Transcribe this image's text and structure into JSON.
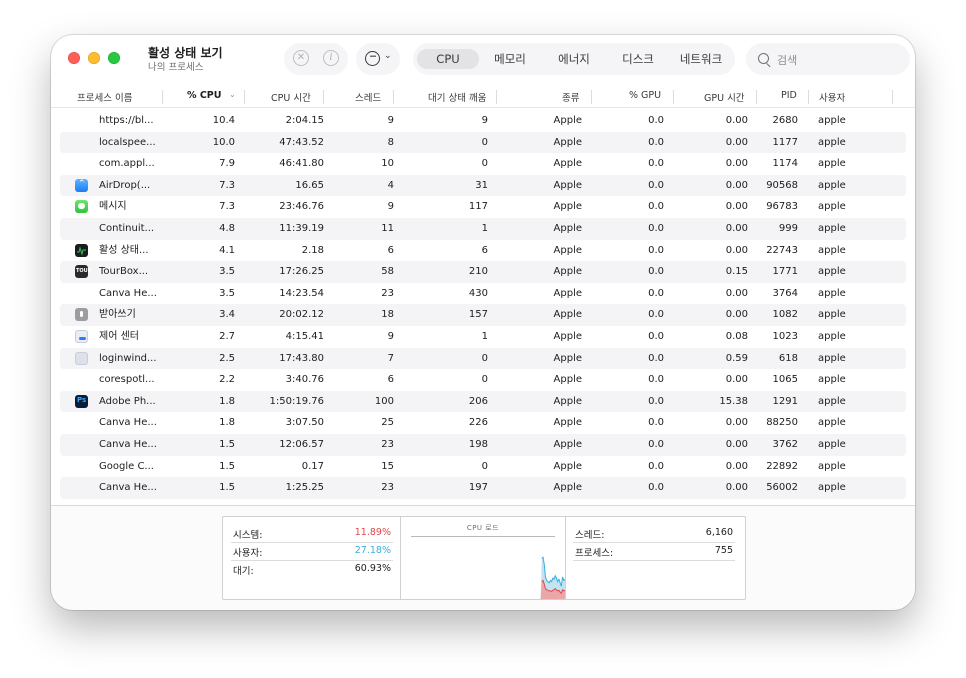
{
  "window": {
    "title": "활성 상태 보기",
    "subtitle": "나의 프로세스"
  },
  "toolbar": {
    "stop_icon": "x-circle-icon",
    "info_icon": "info-circle-icon",
    "more_icon": "ellipsis-circle-icon",
    "tabs": [
      "CPU",
      "메모리",
      "에너지",
      "디스크",
      "네트워크"
    ],
    "active_tab": "CPU",
    "search_placeholder": "검색"
  },
  "columns": [
    "프로세스 이름",
    "% CPU",
    "CPU 시간",
    "스레드",
    "대기 상태 깨움",
    "종류",
    "% GPU",
    "GPU 시간",
    "PID",
    "사용자"
  ],
  "sort_column": "% CPU",
  "rows": [
    {
      "name": "https://bl...",
      "cpu": "10.4",
      "cpu_time": "2:04.15",
      "threads": "9",
      "wakeups": "9",
      "kind": "Apple",
      "gpu": "0.0",
      "gpu_time": "0.00",
      "pid": "2680",
      "user": "apple",
      "icon": "none"
    },
    {
      "name": "localspee...",
      "cpu": "10.0",
      "cpu_time": "47:43.52",
      "threads": "8",
      "wakeups": "0",
      "kind": "Apple",
      "gpu": "0.0",
      "gpu_time": "0.00",
      "pid": "1177",
      "user": "apple",
      "icon": "none"
    },
    {
      "name": "com.appl...",
      "cpu": "7.9",
      "cpu_time": "46:41.80",
      "threads": "10",
      "wakeups": "0",
      "kind": "Apple",
      "gpu": "0.0",
      "gpu_time": "0.00",
      "pid": "1174",
      "user": "apple",
      "icon": "none"
    },
    {
      "name": "AirDrop(...",
      "cpu": "7.3",
      "cpu_time": "16.65",
      "threads": "4",
      "wakeups": "31",
      "kind": "Apple",
      "gpu": "0.0",
      "gpu_time": "0.00",
      "pid": "90568",
      "user": "apple",
      "icon": "airdrop-icon"
    },
    {
      "name": "메시지",
      "cpu": "7.3",
      "cpu_time": "23:46.76",
      "threads": "9",
      "wakeups": "117",
      "kind": "Apple",
      "gpu": "0.0",
      "gpu_time": "0.00",
      "pid": "96783",
      "user": "apple",
      "icon": "messages-icon"
    },
    {
      "name": "Continuit...",
      "cpu": "4.8",
      "cpu_time": "11:39.19",
      "threads": "11",
      "wakeups": "1",
      "kind": "Apple",
      "gpu": "0.0",
      "gpu_time": "0.00",
      "pid": "999",
      "user": "apple",
      "icon": "none"
    },
    {
      "name": "활성 상태...",
      "cpu": "4.1",
      "cpu_time": "2.18",
      "threads": "6",
      "wakeups": "6",
      "kind": "Apple",
      "gpu": "0.0",
      "gpu_time": "0.00",
      "pid": "22743",
      "user": "apple",
      "icon": "activity-monitor-icon"
    },
    {
      "name": "TourBox...",
      "cpu": "3.5",
      "cpu_time": "17:26.25",
      "threads": "58",
      "wakeups": "210",
      "kind": "Apple",
      "gpu": "0.0",
      "gpu_time": "0.15",
      "pid": "1771",
      "user": "apple",
      "icon": "tourbox-icon"
    },
    {
      "name": "Canva He...",
      "cpu": "3.5",
      "cpu_time": "14:23.54",
      "threads": "23",
      "wakeups": "430",
      "kind": "Apple",
      "gpu": "0.0",
      "gpu_time": "0.00",
      "pid": "3764",
      "user": "apple",
      "icon": "none"
    },
    {
      "name": "받아쓰기",
      "cpu": "3.4",
      "cpu_time": "20:02.12",
      "threads": "18",
      "wakeups": "157",
      "kind": "Apple",
      "gpu": "0.0",
      "gpu_time": "0.00",
      "pid": "1082",
      "user": "apple",
      "icon": "dictation-icon"
    },
    {
      "name": "제어 센터",
      "cpu": "2.7",
      "cpu_time": "4:15.41",
      "threads": "9",
      "wakeups": "1",
      "kind": "Apple",
      "gpu": "0.0",
      "gpu_time": "0.08",
      "pid": "1023",
      "user": "apple",
      "icon": "control-center-icon"
    },
    {
      "name": "loginwind...",
      "cpu": "2.5",
      "cpu_time": "17:43.80",
      "threads": "7",
      "wakeups": "0",
      "kind": "Apple",
      "gpu": "0.0",
      "gpu_time": "0.59",
      "pid": "618",
      "user": "apple",
      "icon": "loginwindow-icon"
    },
    {
      "name": "corespotl...",
      "cpu": "2.2",
      "cpu_time": "3:40.76",
      "threads": "6",
      "wakeups": "0",
      "kind": "Apple",
      "gpu": "0.0",
      "gpu_time": "0.00",
      "pid": "1065",
      "user": "apple",
      "icon": "none"
    },
    {
      "name": "Adobe Ph...",
      "cpu": "1.8",
      "cpu_time": "1:50:19.76",
      "threads": "100",
      "wakeups": "206",
      "kind": "Apple",
      "gpu": "0.0",
      "gpu_time": "15.38",
      "pid": "1291",
      "user": "apple",
      "icon": "photoshop-icon"
    },
    {
      "name": "Canva He...",
      "cpu": "1.8",
      "cpu_time": "3:07.50",
      "threads": "25",
      "wakeups": "226",
      "kind": "Apple",
      "gpu": "0.0",
      "gpu_time": "0.00",
      "pid": "88250",
      "user": "apple",
      "icon": "none"
    },
    {
      "name": "Canva He...",
      "cpu": "1.5",
      "cpu_time": "12:06.57",
      "threads": "23",
      "wakeups": "198",
      "kind": "Apple",
      "gpu": "0.0",
      "gpu_time": "0.00",
      "pid": "3762",
      "user": "apple",
      "icon": "none"
    },
    {
      "name": "Google C...",
      "cpu": "1.5",
      "cpu_time": "0.17",
      "threads": "15",
      "wakeups": "0",
      "kind": "Apple",
      "gpu": "0.0",
      "gpu_time": "0.00",
      "pid": "22892",
      "user": "apple",
      "icon": "none"
    },
    {
      "name": "Canva He...",
      "cpu": "1.5",
      "cpu_time": "1:25.25",
      "threads": "23",
      "wakeups": "197",
      "kind": "Apple",
      "gpu": "0.0",
      "gpu_time": "0.00",
      "pid": "56002",
      "user": "apple",
      "icon": "none"
    }
  ],
  "stats": {
    "system_label": "시스템:",
    "system_value": "11.89%",
    "user_label": "사용자:",
    "user_value": "27.18%",
    "idle_label": "대기:",
    "idle_value": "60.93%",
    "cpu_load_title": "CPU 로드",
    "threads_label": "스레드:",
    "threads_value": "6,160",
    "processes_label": "프로세스:",
    "processes_value": "755"
  },
  "colors": {
    "system": "#e0484c",
    "user": "#3aaedb",
    "user_fill": "#c4e3f2",
    "system_fill": "#e9a7a9",
    "row_alt": "#f4f4f6"
  },
  "cpu_load_graph": {
    "user_total_pct": [
      0,
      0,
      0,
      0,
      0,
      0,
      0,
      0,
      0,
      0,
      0,
      0,
      0,
      0,
      0,
      0,
      0,
      0,
      0,
      0,
      0,
      0,
      0,
      0,
      0,
      0,
      0,
      0,
      0,
      0,
      0,
      0,
      0,
      0,
      0,
      0,
      0,
      0,
      0,
      0,
      0,
      0,
      0,
      0,
      0,
      0,
      0,
      0,
      0,
      0,
      0,
      0,
      0,
      0,
      0,
      0,
      0,
      0,
      0,
      0,
      0,
      0,
      0,
      0,
      0,
      0,
      0,
      0,
      0,
      0,
      0,
      0,
      0,
      0,
      0,
      0,
      0,
      0,
      0,
      0,
      0,
      0,
      0,
      0,
      0,
      0,
      0,
      0,
      0,
      0,
      0,
      0,
      0,
      0,
      0,
      0,
      0,
      0,
      0,
      0,
      0,
      0,
      0,
      0,
      0,
      0,
      0,
      70,
      72,
      60,
      38,
      32,
      30,
      28,
      32,
      30,
      36,
      34,
      40,
      36,
      30,
      34,
      28,
      22,
      38,
      32,
      34
    ],
    "system_pct": [
      0,
      0,
      0,
      0,
      0,
      0,
      0,
      0,
      0,
      0,
      0,
      0,
      0,
      0,
      0,
      0,
      0,
      0,
      0,
      0,
      0,
      0,
      0,
      0,
      0,
      0,
      0,
      0,
      0,
      0,
      0,
      0,
      0,
      0,
      0,
      0,
      0,
      0,
      0,
      0,
      0,
      0,
      0,
      0,
      0,
      0,
      0,
      0,
      0,
      0,
      0,
      0,
      0,
      0,
      0,
      0,
      0,
      0,
      0,
      0,
      0,
      0,
      0,
      0,
      0,
      0,
      0,
      0,
      0,
      0,
      0,
      0,
      0,
      0,
      0,
      0,
      0,
      0,
      0,
      0,
      0,
      0,
      0,
      0,
      0,
      0,
      0,
      0,
      0,
      0,
      0,
      0,
      0,
      0,
      0,
      0,
      0,
      0,
      0,
      0,
      0,
      0,
      0,
      0,
      0,
      0,
      0,
      30,
      32,
      26,
      18,
      16,
      15,
      14,
      14,
      13,
      15,
      16,
      18,
      16,
      14,
      15,
      12,
      10,
      16,
      14,
      15
    ]
  }
}
